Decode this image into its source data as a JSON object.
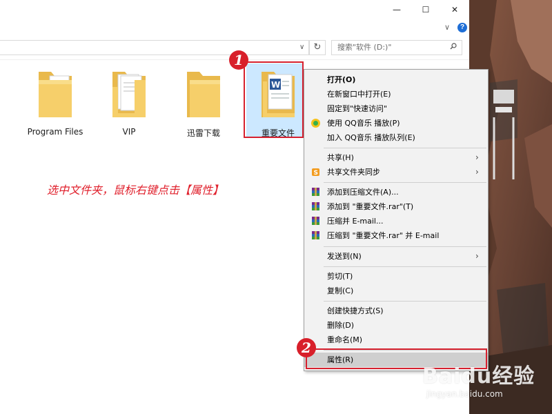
{
  "window": {
    "minimize_glyph": "—",
    "maximize_glyph": "☐",
    "close_glyph": "✕",
    "ribbon_chevron": "∨",
    "help_glyph": "?"
  },
  "address_bar": {
    "dropdown_glyph": "∨",
    "refresh_glyph": "↻",
    "search_placeholder": "搜索\"软件 (D:)\""
  },
  "files": [
    {
      "label": "Program Files",
      "icon": "folder-with-documents-icon"
    },
    {
      "label": "VIP",
      "icon": "folder-with-pages-icon"
    },
    {
      "label": "迅雷下载",
      "icon": "empty-folder-icon"
    },
    {
      "label": "重要文件",
      "icon": "folder-with-word-document-icon",
      "selected": true
    }
  ],
  "annotation": {
    "instruction": "选中文件夹，鼠标右键点击【属性】",
    "marker1": "1",
    "marker2": "2"
  },
  "context_menu": {
    "items": [
      {
        "label": "打开(O)",
        "bold": true
      },
      {
        "label": "在新窗口中打开(E)"
      },
      {
        "label": "固定到\"快速访问\""
      },
      {
        "label": "使用 QQ音乐 播放(P)",
        "icon": "qq-music-icon"
      },
      {
        "label": "加入 QQ音乐 播放队列(E)"
      },
      {
        "label": "共享(H)",
        "submenu": true
      },
      {
        "label": "共享文件夹同步",
        "icon": "sync-folder-icon",
        "submenu": true
      },
      {
        "label": "添加到压缩文件(A)...",
        "icon": "winrar-icon"
      },
      {
        "label": "添加到 \"重要文件.rar\"(T)",
        "icon": "winrar-icon"
      },
      {
        "label": "压缩并 E-mail...",
        "icon": "winrar-icon"
      },
      {
        "label": "压缩到 \"重要文件.rar\" 并 E-mail",
        "icon": "winrar-icon"
      },
      {
        "label": "发送到(N)",
        "submenu": true
      },
      {
        "label": "剪切(T)"
      },
      {
        "label": "复制(C)"
      },
      {
        "label": "创建快捷方式(S)"
      },
      {
        "label": "删除(D)"
      },
      {
        "label": "重命名(M)"
      },
      {
        "label": "属性(R)",
        "highlighted": true
      }
    ],
    "submenu_arrow": "›"
  },
  "watermark": {
    "brand": "Baidu经验",
    "url": "jingyan.baidu.com"
  },
  "colors": {
    "accent_red": "#d6202e",
    "selection_blue": "#cce8ff",
    "folder_yellow": "#f6cf6a",
    "menu_bg": "#f2f2f2"
  }
}
